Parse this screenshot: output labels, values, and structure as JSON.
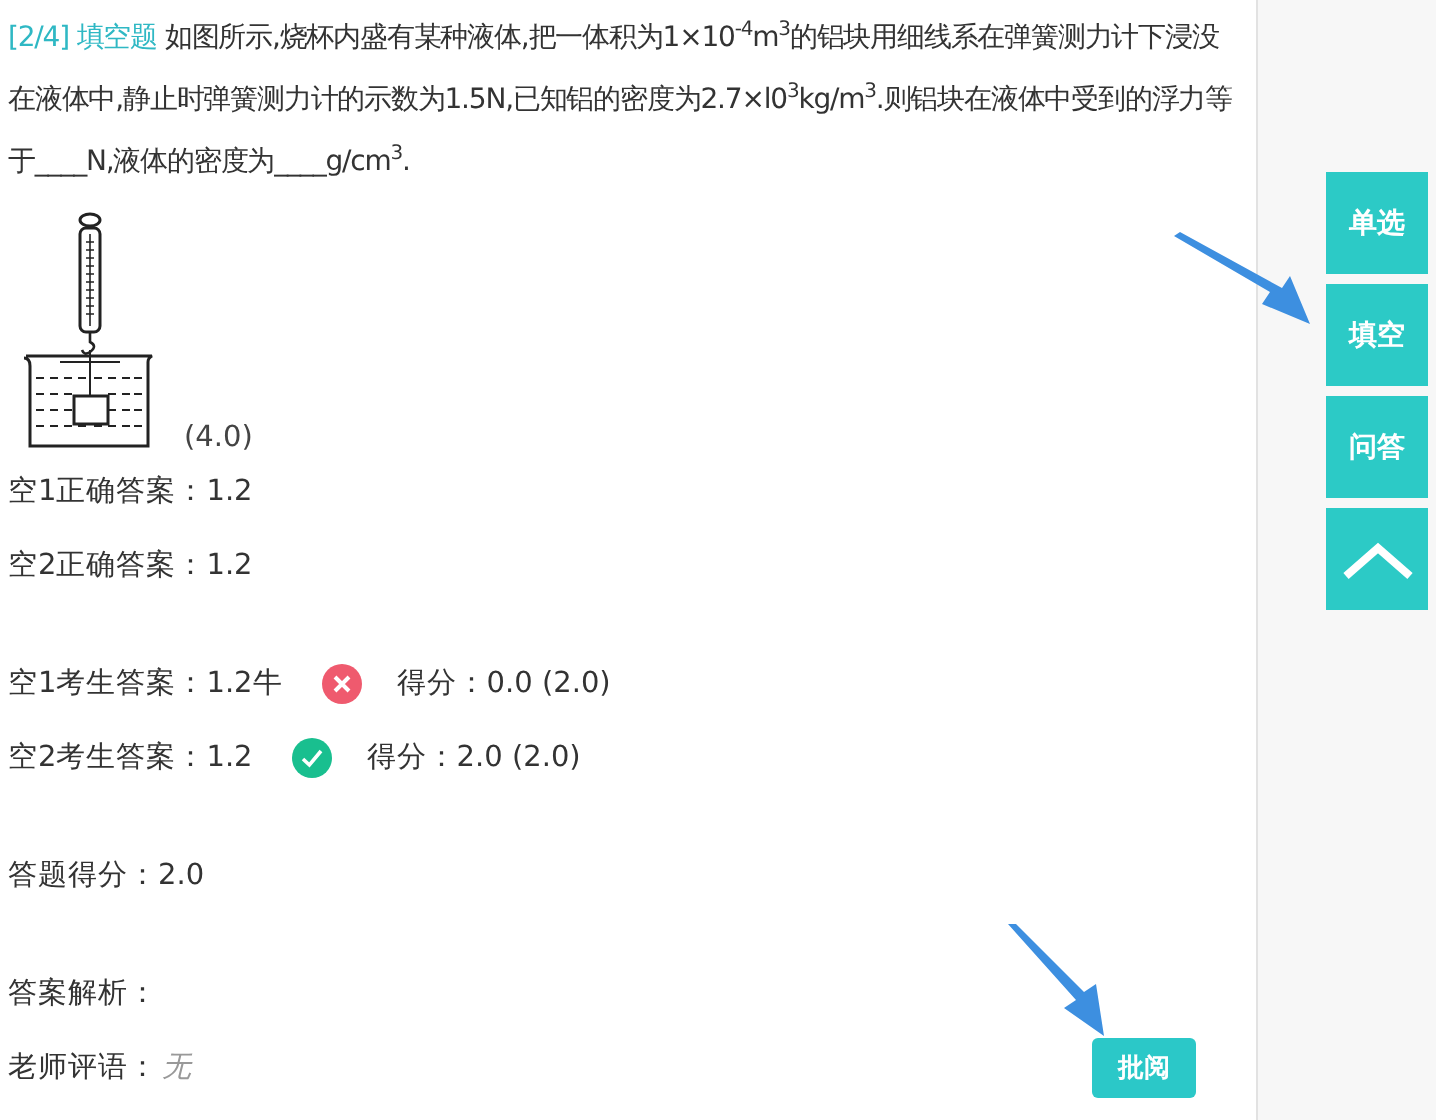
{
  "question": {
    "number": "[2/4]",
    "type": "填空题",
    "text": "如图所示,烧杯内盛有某种液体,把一体积为1×10$^{-4}$m$^{3}$的铝块用细线系在弹簧测力计下浸没在液体中,静止时弹簧测力计的示数为1.5N,已知铝的密度为2.7×l0$^{3}$kg/m$^{3}$.则铝块在液体中受到的浮力等于____N,液体的密度为____g/cm$^{3}$."
  },
  "figure": {
    "score": "(4.0)"
  },
  "correct_answers": [
    {
      "label": "空1正确答案：",
      "value": "1.2"
    },
    {
      "label": "空2正确答案：",
      "value": "1.2"
    }
  ],
  "student_answers": [
    {
      "label": "空1考生答案：",
      "value": "1.2牛",
      "correct": false,
      "score_label": "得分：",
      "score": "0.0",
      "max": "(2.0)"
    },
    {
      "label": "空2考生答案：",
      "value": "1.2",
      "correct": true,
      "score_label": "得分：",
      "score": "2.0",
      "max": "(2.0)"
    }
  ],
  "total": {
    "label": "答题得分：",
    "value": "2.0"
  },
  "analysis": {
    "label": "答案解析："
  },
  "comment": {
    "label": "老师评语：",
    "value": "无"
  },
  "review_button": "批阅",
  "nav": [
    "单选",
    "填空",
    "问答"
  ]
}
